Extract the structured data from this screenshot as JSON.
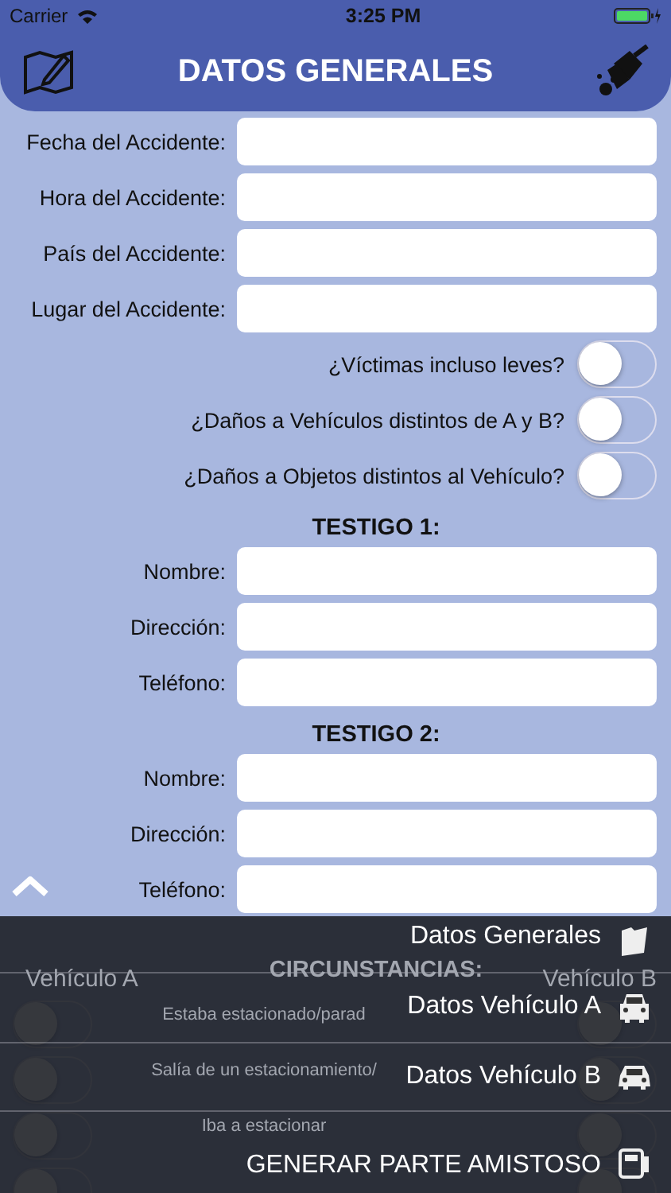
{
  "status_bar": {
    "carrier": "Carrier",
    "time": "3:25 PM"
  },
  "header": {
    "title": "DATOS GENERALES"
  },
  "fields": [
    {
      "label": "Fecha del Accidente:"
    },
    {
      "label": "Hora del Accidente:"
    },
    {
      "label": "País del Accidente:"
    },
    {
      "label": "Lugar del Accidente:"
    }
  ],
  "questions": [
    {
      "label": "¿Víctimas incluso leves?",
      "on": false
    },
    {
      "label": "¿Daños a Vehículos distintos de A y B?",
      "on": false
    },
    {
      "label": "¿Daños a Objetos distintos al Vehículo?",
      "on": false
    }
  ],
  "witnesses": [
    {
      "title": "TESTIGO 1:",
      "fields": [
        {
          "label": "Nombre:"
        },
        {
          "label": "Dirección:"
        },
        {
          "label": "Teléfono:"
        }
      ]
    },
    {
      "title": "TESTIGO 2:",
      "fields": [
        {
          "label": "Nombre:"
        },
        {
          "label": "Dirección:"
        },
        {
          "label": "Teléfono:"
        }
      ]
    }
  ],
  "circumstances": {
    "title": "CIRCUNSTANCIAS:",
    "column_a": "Vehículo A",
    "column_b": "Vehículo B",
    "rows": [
      {
        "label": "Estaba estacionado/parad",
        "a_on": false,
        "b_on": false
      },
      {
        "label": "Salía de un estacionamiento/",
        "a_on": false,
        "b_on": false
      },
      {
        "label": "Iba a estacionar",
        "a_on": false,
        "b_on": false
      },
      {
        "a_on": false,
        "b_on": false
      }
    ]
  },
  "menu": {
    "items": [
      {
        "label": "Datos Generales",
        "kind": "folder"
      },
      {
        "label": "Datos Vehículo A",
        "kind": "car-front"
      },
      {
        "label": "Datos Vehículo B",
        "kind": "car"
      },
      {
        "label": "GENERAR PARTE AMISTOSO",
        "kind": "document"
      }
    ]
  }
}
